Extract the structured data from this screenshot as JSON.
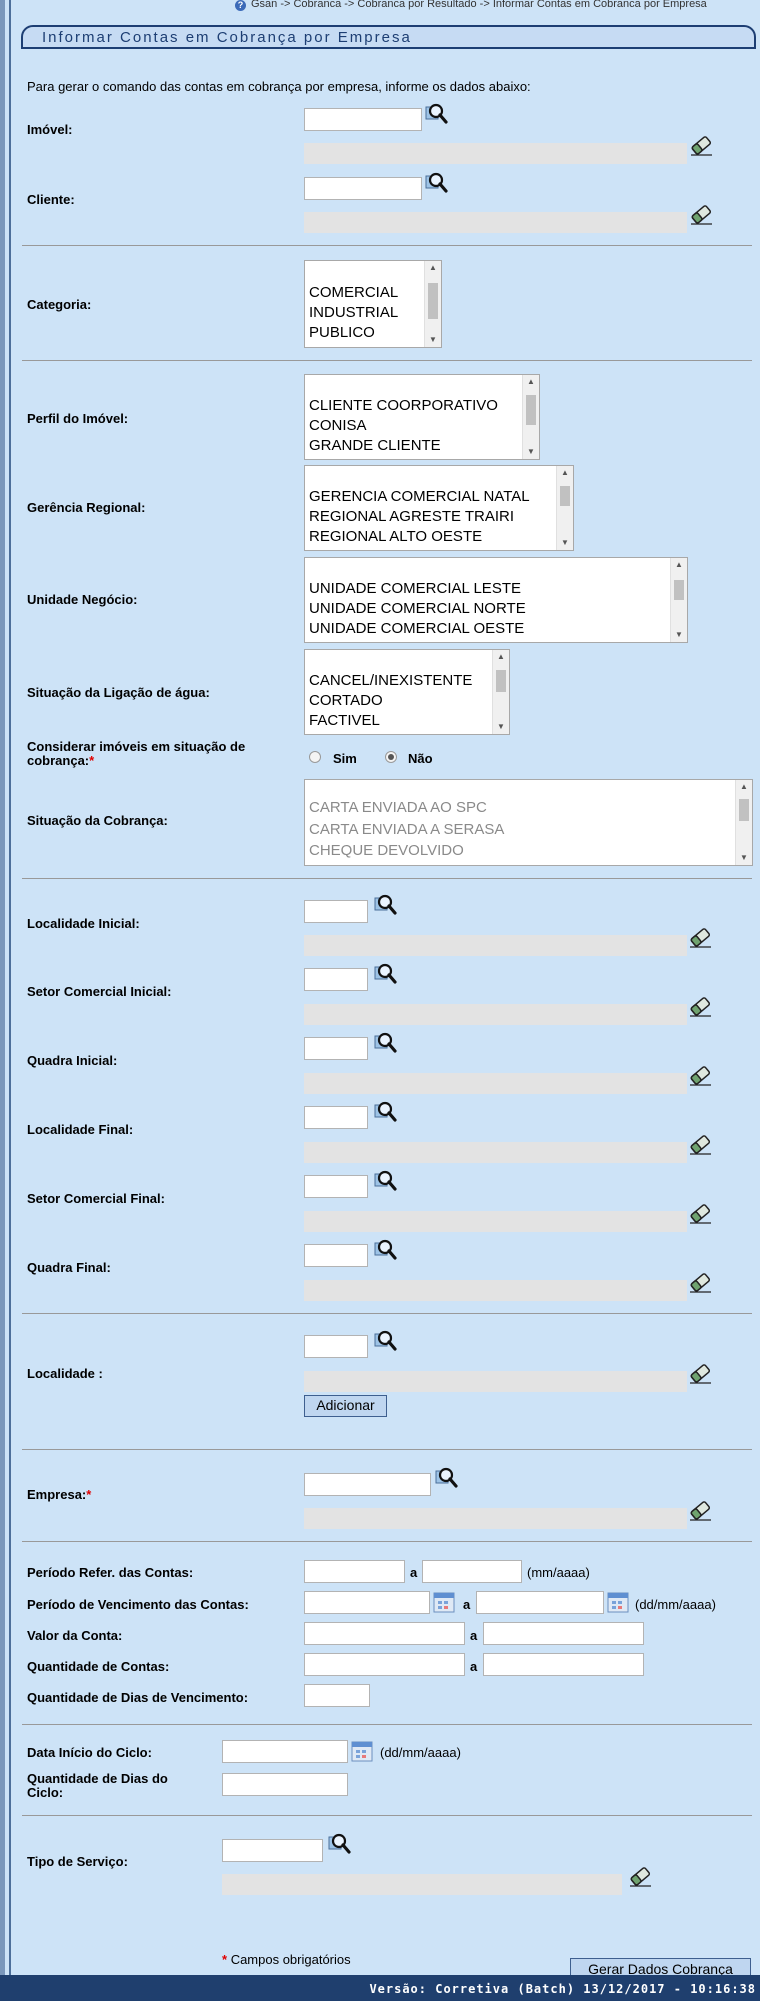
{
  "breadcrumb": "Gsan -> Cobranca -> Cobranca por Resultado -> Informar Contas em Cobranca por Empresa",
  "title": "Informar Contas em Cobrança por Empresa",
  "intro": "Para gerar o comando das contas em cobrança por empresa, informe os dados abaixo:",
  "labels": {
    "imovel": "Imóvel:",
    "cliente": "Cliente:",
    "categoria": "Categoria:",
    "perfil": "Perfil do Imóvel:",
    "gerencia": "Gerência Regional:",
    "unidade": "Unidade Negócio:",
    "situacao_agua": "Situação da Ligação de água:",
    "considerar": "Considerar imóveis em situação de cobrança:",
    "situacao_cobranca": "Situação da Cobrança:",
    "localidade_inicial": "Localidade Inicial:",
    "setor_inicial": "Setor Comercial Inicial:",
    "quadra_inicial": "Quadra Inicial:",
    "localidade_final": "Localidade Final:",
    "setor_final": "Setor Comercial Final:",
    "quadra_final": "Quadra Final:",
    "localidade": "Localidade :",
    "empresa": "Empresa:",
    "periodo_refer": "Período Refer. das Contas:",
    "periodo_venc": "Período de Vencimento das Contas:",
    "valor": "Valor da Conta:",
    "quantidade": "Quantidade de Contas:",
    "dias_venc": "Quantidade de Dias de Vencimento:",
    "data_inicio": "Data Início do Ciclo:",
    "dias_ciclo": "Quantidade de Dias do Ciclo:",
    "tipo_servico": "Tipo de Serviço:"
  },
  "required_mark": "*",
  "lists": {
    "categoria": [
      "COMERCIAL",
      "INDUSTRIAL",
      "PUBLICO"
    ],
    "perfil": [
      "CLIENTE COORPORATIVO",
      "CONISA",
      "GRANDE CLIENTE"
    ],
    "gerencia": [
      "GERENCIA COMERCIAL NATAL",
      "REGIONAL AGRESTE TRAIRI",
      "REGIONAL ALTO OESTE"
    ],
    "unidade": [
      "UNIDADE COMERCIAL LESTE",
      "UNIDADE COMERCIAL NORTE",
      "UNIDADE COMERCIAL OESTE"
    ],
    "situacao_agua": [
      "CANCEL/INEXISTENTE",
      "CORTADO",
      "FACTIVEL"
    ],
    "situacao_cobranca": [
      "CARTA ENVIADA AO SPC",
      "CARTA ENVIADA A SERASA",
      "CHEQUE DEVOLVIDO"
    ]
  },
  "radio": {
    "sim": "Sim",
    "nao": "Não",
    "selected": "nao"
  },
  "separator_a": "a",
  "formats": {
    "mmaaaa": "(mm/aaaa)",
    "ddmmaaaa": "(dd/mm/aaaa)"
  },
  "buttons": {
    "adicionar": "Adicionar",
    "gerar": "Gerar Dados Cobrança"
  },
  "required_note": "Campos obrigatórios",
  "footer": "Versão: Corretiva (Batch) 13/12/2017 - 10:16:38",
  "colors": {
    "background": "#cde3f7",
    "title": "#1d3e73",
    "required": "#e00000",
    "footer": "#1f3f6e"
  },
  "icons": [
    "search-icon",
    "eraser-icon",
    "calendar-icon",
    "help-icon"
  ]
}
